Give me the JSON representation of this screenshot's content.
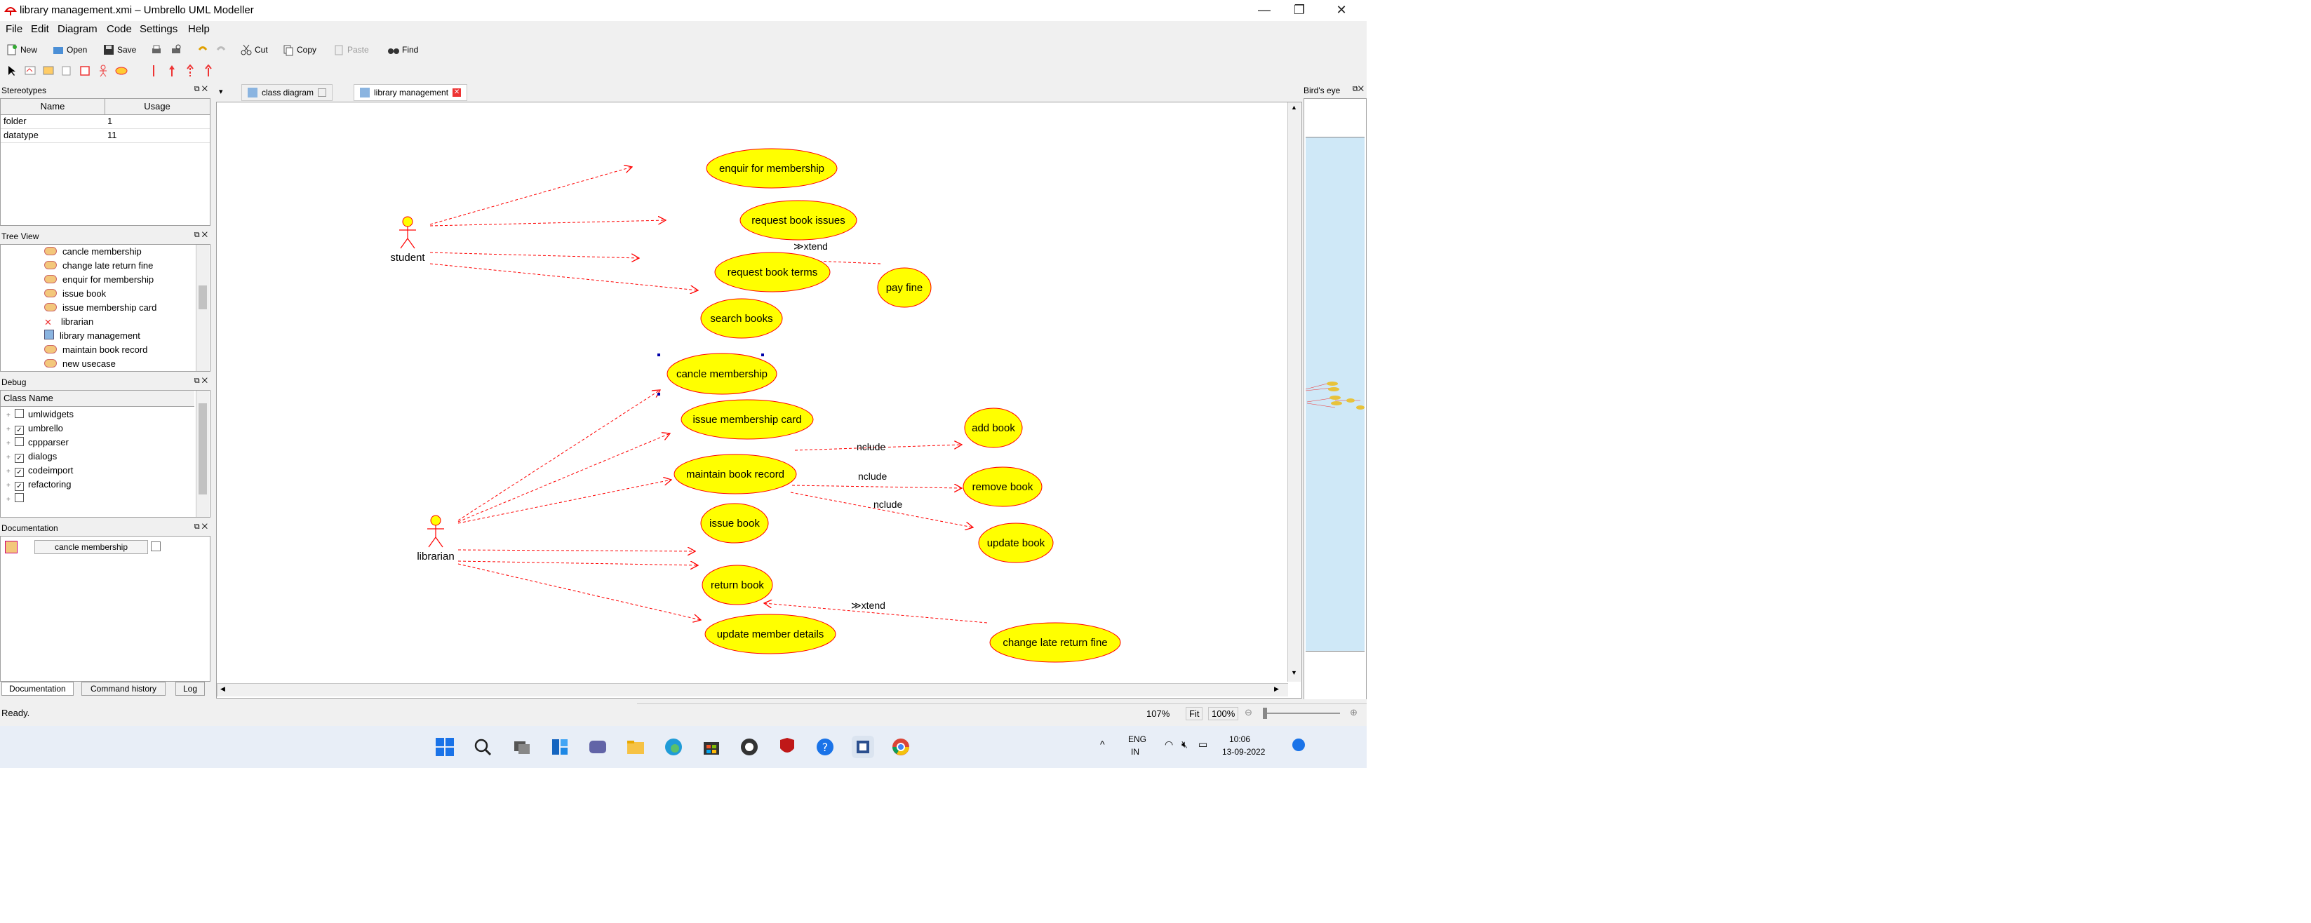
{
  "window": {
    "title": "library management.xmi – Umbrello UML Modeller",
    "controls": [
      "—",
      "❐",
      "✕"
    ]
  },
  "menu": [
    "File",
    "Edit",
    "Diagram",
    "Code",
    "Settings",
    "Help"
  ],
  "toolbar": {
    "new": "New",
    "open": "Open",
    "save": "Save",
    "cut": "Cut",
    "copy": "Copy",
    "paste": "Paste",
    "find": "Find"
  },
  "stereotypes": {
    "title": "Stereotypes",
    "col_name": "Name",
    "col_usage": "Usage",
    "rows": [
      {
        "name": "folder",
        "usage": "1"
      },
      {
        "name": "datatype",
        "usage": "11"
      }
    ]
  },
  "tree_view": {
    "title": "Tree View",
    "items": [
      "cancle membership",
      "change late return fine",
      "enquir for membership",
      "issue book",
      "issue membership card",
      "librarian",
      "library management",
      "maintain book record",
      "new usecase"
    ]
  },
  "debug": {
    "title": "Debug",
    "col": "Class Name",
    "items": [
      {
        "name": "umlwidgets",
        "checked": false
      },
      {
        "name": "umbrello",
        "checked": true
      },
      {
        "name": "cppparser",
        "checked": false
      },
      {
        "name": "dialogs",
        "checked": true
      },
      {
        "name": "codeimport",
        "checked": true
      },
      {
        "name": "refactoring",
        "checked": true
      },
      {
        "name": "",
        "checked": false
      }
    ]
  },
  "documentation": {
    "title": "Documentation",
    "selected": "cancle membership",
    "tabs": [
      "Documentation",
      "Command history",
      "Log"
    ]
  },
  "tabs": [
    {
      "label": "class diagram",
      "active": false
    },
    {
      "label": "library management",
      "active": true
    }
  ],
  "birds_eye": {
    "title": "Bird's eye"
  },
  "diagram": {
    "actors": [
      {
        "id": "student",
        "label": "student"
      },
      {
        "id": "librarian",
        "label": "librarian"
      }
    ],
    "usecases": [
      {
        "id": "enquir",
        "label": "enquir for membership"
      },
      {
        "id": "request_issues",
        "label": "request book issues"
      },
      {
        "id": "request_terms",
        "label": "request book terms"
      },
      {
        "id": "pay_fine",
        "label": "pay fine"
      },
      {
        "id": "search_books",
        "label": "search books"
      },
      {
        "id": "cancle",
        "label": "cancle membership"
      },
      {
        "id": "issue_card",
        "label": "issue membership card"
      },
      {
        "id": "add_book",
        "label": "add book"
      },
      {
        "id": "maintain",
        "label": "maintain book record"
      },
      {
        "id": "remove_book",
        "label": "remove book"
      },
      {
        "id": "issue_book",
        "label": "issue book"
      },
      {
        "id": "update_book",
        "label": "update book"
      },
      {
        "id": "return_book",
        "label": "return book"
      },
      {
        "id": "update_member",
        "label": "update member details"
      },
      {
        "id": "change_fine",
        "label": "change late return fine"
      }
    ],
    "labels": {
      "extend1": "≫xtend",
      "include1": "nclude",
      "include2": "nclude",
      "include3": "nclude",
      "extend2": "≫xtend"
    },
    "fill_color": "#ffff00",
    "edge_color": "#ff0000"
  },
  "status": {
    "text": "Ready.",
    "zoom": "107%",
    "fit": "Fit",
    "zoom100": "100%"
  },
  "taskbar": {
    "lang1": "ENG",
    "lang2": "IN",
    "time": "10:06",
    "date": "13-09-2022"
  }
}
